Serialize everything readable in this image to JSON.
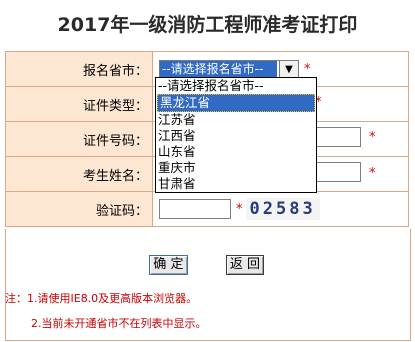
{
  "title": "2017年一级消防工程师准考证打印",
  "form": {
    "province_label": "报名省市：",
    "province_selected": "--请选择报名省市--",
    "cert_type_label": "证件类型：",
    "cert_no_label": "证件号码：",
    "name_label": "考生姓名：",
    "captcha_label": "验证码：",
    "required_mark": "*",
    "captcha_text": "02583"
  },
  "dropdown": {
    "options": [
      "--请选择报名省市--",
      "黑龙江省",
      "江苏省",
      "江西省",
      "山东省",
      "重庆市",
      "甘肃省"
    ],
    "highlighted_index": 1
  },
  "buttons": {
    "confirm": "确 定",
    "back": "返 回"
  },
  "notes": {
    "prefix": "注：",
    "note1": "1.请使用IE8.0及更高版本浏览器。",
    "note2": "2.当前未开通省市不在列表中显示。"
  }
}
